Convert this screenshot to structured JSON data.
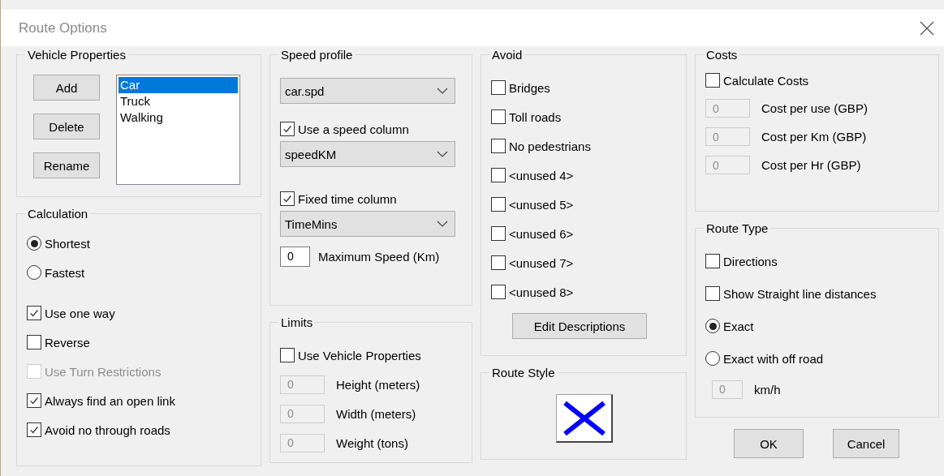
{
  "window": {
    "title": "Route Options"
  },
  "vehicle_properties": {
    "title": "Vehicle Properties",
    "buttons": [
      "Add",
      "Delete",
      "Rename"
    ],
    "vehicles": [
      {
        "label": "Car",
        "selected": true
      },
      {
        "label": "Truck",
        "selected": false
      },
      {
        "label": "Walking",
        "selected": false
      }
    ]
  },
  "calculation": {
    "title": "Calculation",
    "options": [
      {
        "label": "Shortest",
        "selected": true
      },
      {
        "label": "Fastest",
        "selected": false
      }
    ],
    "checks": [
      {
        "label": "Use one way",
        "checked": true,
        "disabled": false
      },
      {
        "label": "Reverse",
        "checked": false,
        "disabled": false
      },
      {
        "label": "Use Turn Restrictions",
        "checked": false,
        "disabled": true
      },
      {
        "label": "Always find an open link",
        "checked": true,
        "disabled": false
      },
      {
        "label": "Avoid no through roads",
        "checked": true,
        "disabled": false
      }
    ]
  },
  "speed_profile": {
    "title": "Speed profile",
    "profile": "car.spd",
    "speed_column": {
      "label": "Use a speed column",
      "checked": true,
      "value": "speedKM"
    },
    "fixed_time": {
      "label": "Fixed time column",
      "checked": true,
      "value": "TimeMins"
    },
    "max_speed": {
      "value": "0",
      "label": "Maximum Speed (Km)",
      "disabled": false
    }
  },
  "limits": {
    "title": "Limits",
    "use_vehicle": {
      "label": "Use Vehicle Properties",
      "checked": false
    },
    "fields": [
      {
        "value": "0",
        "label": "Height (meters)",
        "disabled": true
      },
      {
        "value": "0",
        "label": "Width (meters)",
        "disabled": true
      },
      {
        "value": "0",
        "label": "Weight (tons)",
        "disabled": true
      }
    ]
  },
  "avoid": {
    "title": "Avoid",
    "items": [
      {
        "label": "Bridges",
        "checked": false
      },
      {
        "label": "Toll roads",
        "checked": false
      },
      {
        "label": "No pedestrians",
        "checked": false
      },
      {
        "label": "<unused 4>",
        "checked": false
      },
      {
        "label": "<unused 5>",
        "checked": false
      },
      {
        "label": "<unused 6>",
        "checked": false
      },
      {
        "label": "<unused 7>",
        "checked": false
      },
      {
        "label": "<unused 8>",
        "checked": false
      }
    ],
    "button": "Edit Descriptions"
  },
  "route_style": {
    "title": "Route Style"
  },
  "costs": {
    "title": "Costs",
    "calculate": {
      "label": "Calculate Costs",
      "checked": false
    },
    "fields": [
      {
        "value": "0",
        "label": "Cost per use (GBP)",
        "disabled": true
      },
      {
        "value": "0",
        "label": "Cost per Km (GBP)",
        "disabled": true
      },
      {
        "value": "0",
        "label": "Cost per Hr (GBP)",
        "disabled": true
      }
    ]
  },
  "route_type": {
    "title": "Route Type",
    "checks": [
      {
        "label": "Directions",
        "checked": false
      },
      {
        "label": "Show Straight line distances",
        "checked": false
      }
    ],
    "options": [
      {
        "label": "Exact",
        "selected": true
      },
      {
        "label": "Exact with off road",
        "selected": false
      }
    ],
    "speed": {
      "value": "0",
      "label": "km/h",
      "disabled": true
    }
  },
  "buttons": [
    "OK",
    "Cancel"
  ]
}
